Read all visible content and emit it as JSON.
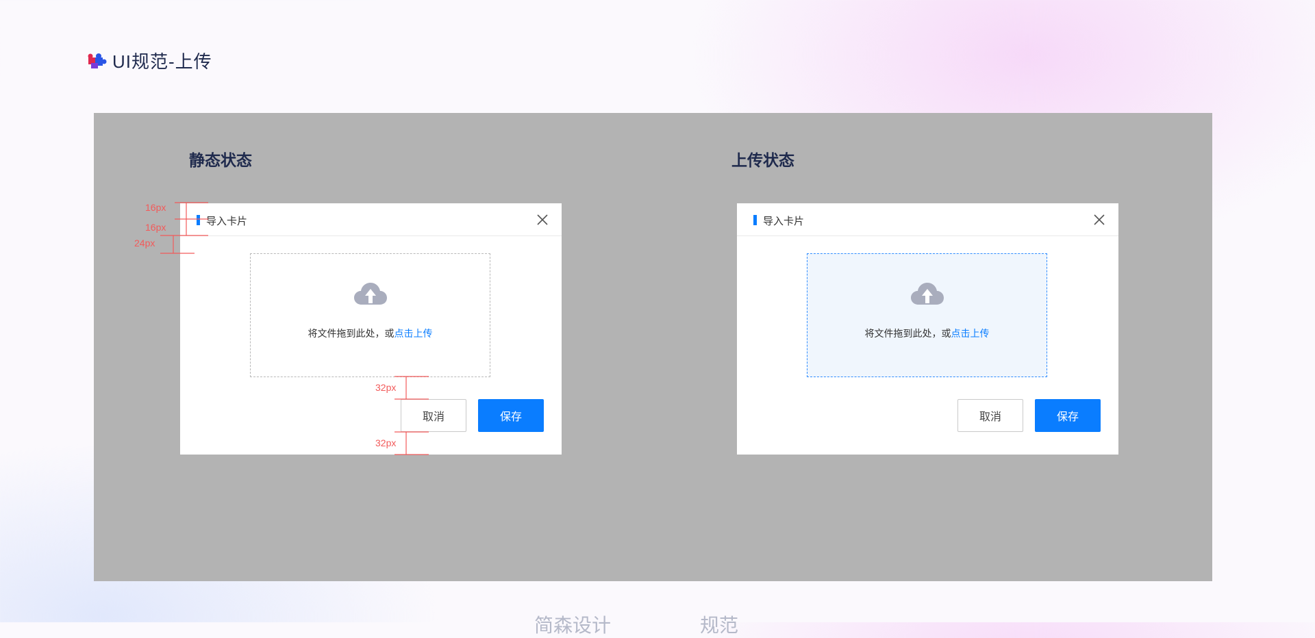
{
  "page": {
    "title": "UI规范-上传",
    "logo_icon": "puzzle-icon"
  },
  "colors": {
    "accent": "#0a7dff",
    "panel": "#b3b3b3",
    "annotation": "#f25a5a",
    "title": "#1f2a4d"
  },
  "sections": [
    {
      "title": "静态状态",
      "dialog": {
        "title": "导入卡片",
        "upload_text": "将文件拖到此处，或",
        "upload_link": "点击上传",
        "cancel_label": "取消",
        "save_label": "保存"
      },
      "annotations": [
        "16px",
        "16px",
        "24px",
        "32px",
        "32px"
      ]
    },
    {
      "title": "上传状态",
      "dialog": {
        "title": "导入卡片",
        "upload_text": "将文件拖到此处，或",
        "upload_link": "点击上传",
        "cancel_label": "取消",
        "save_label": "保存"
      }
    }
  ],
  "footer": {
    "text_left": "简森设计",
    "text_right": "规范"
  }
}
